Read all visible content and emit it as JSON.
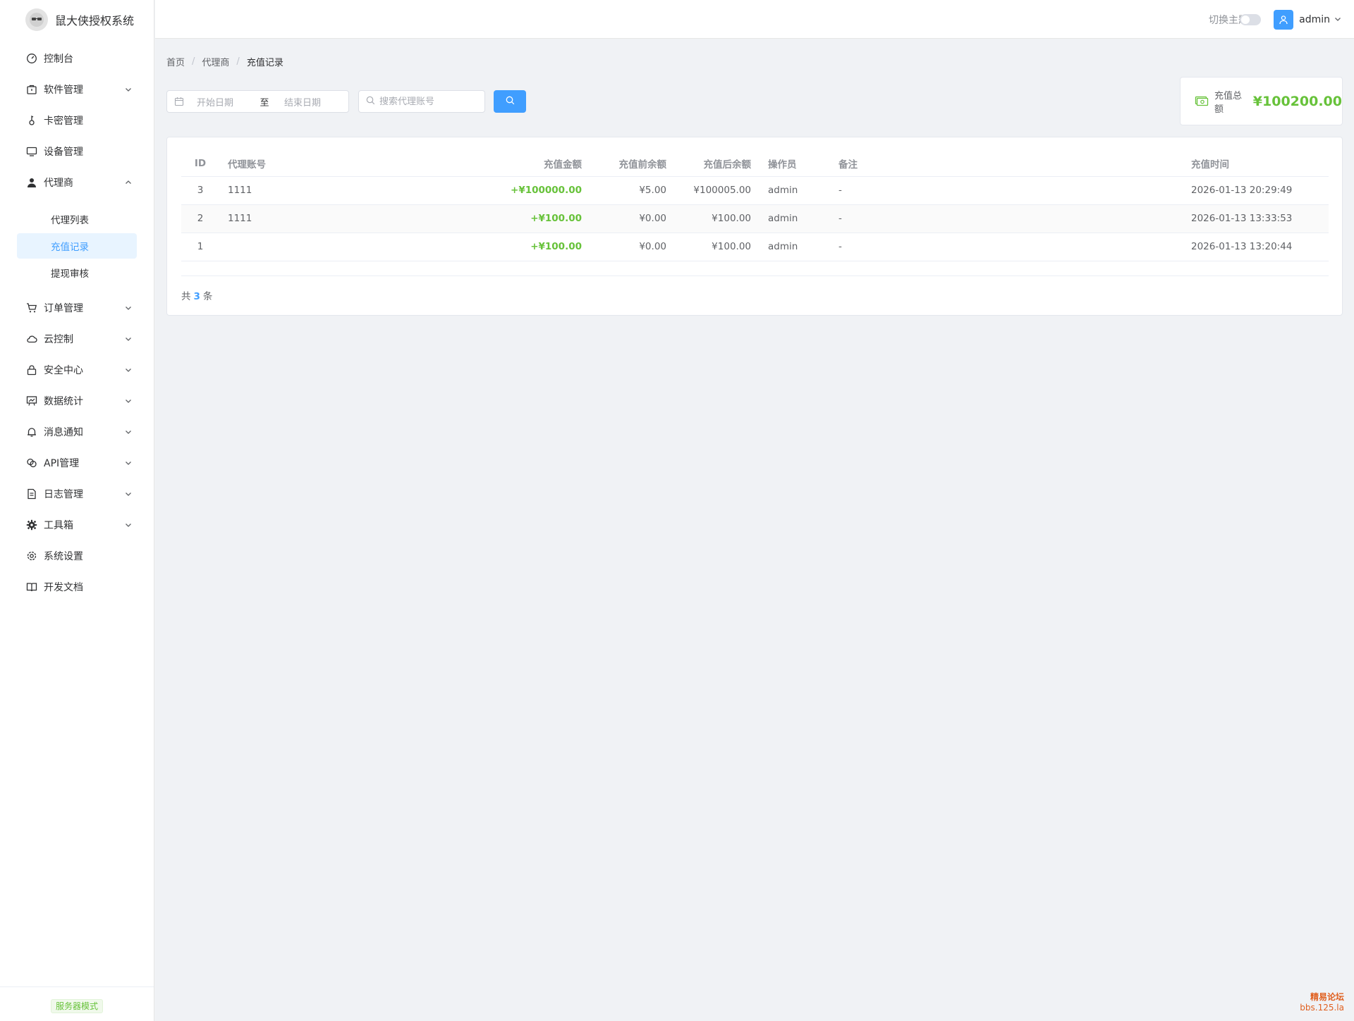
{
  "app": {
    "title": "鼠大侠授权系统"
  },
  "sidebar": {
    "items": [
      {
        "label": "控制台",
        "icon": "dashboard-icon",
        "has_children": false
      },
      {
        "label": "软件管理",
        "icon": "package-icon",
        "has_children": true
      },
      {
        "label": "卡密管理",
        "icon": "key-icon",
        "has_children": false
      },
      {
        "label": "设备管理",
        "icon": "monitor-icon",
        "has_children": false
      },
      {
        "label": "代理商",
        "icon": "user-icon",
        "has_children": true,
        "expanded": true,
        "children": [
          {
            "label": "代理列表"
          },
          {
            "label": "充值记录",
            "active": true
          },
          {
            "label": "提现审核"
          }
        ]
      },
      {
        "label": "订单管理",
        "icon": "cart-icon",
        "has_children": true
      },
      {
        "label": "云控制",
        "icon": "cloud-icon",
        "has_children": true
      },
      {
        "label": "安全中心",
        "icon": "lock-icon",
        "has_children": true
      },
      {
        "label": "数据统计",
        "icon": "chart-icon",
        "has_children": true
      },
      {
        "label": "消息通知",
        "icon": "bell-icon",
        "has_children": true
      },
      {
        "label": "API管理",
        "icon": "link-icon",
        "has_children": true
      },
      {
        "label": "日志管理",
        "icon": "document-icon",
        "has_children": true
      },
      {
        "label": "工具箱",
        "icon": "gear-solid-icon",
        "has_children": true
      },
      {
        "label": "系统设置",
        "icon": "settings-icon",
        "has_children": false
      },
      {
        "label": "开发文档",
        "icon": "book-icon",
        "has_children": false
      }
    ],
    "mode_badge": "服务器模式"
  },
  "header": {
    "theme_toggle_label": "切换主题",
    "theme_dark": false,
    "username": "admin"
  },
  "breadcrumb": [
    "首页",
    "代理商",
    "充值记录"
  ],
  "filters": {
    "start_placeholder": "开始日期",
    "range_separator": "至",
    "end_placeholder": "结束日期",
    "search_placeholder": "搜索代理账号"
  },
  "summary": {
    "label": "充值总额",
    "value": "¥100200.00"
  },
  "table": {
    "columns": [
      "ID",
      "代理账号",
      "充值金额",
      "充值前余额",
      "充值后余额",
      "操作员",
      "备注",
      "充值时间"
    ],
    "rows": [
      {
        "id": "3",
        "account": "1111",
        "amount": "+¥100000.00",
        "before": "¥5.00",
        "after": "¥100005.00",
        "operator": "admin",
        "note": "-",
        "time": "2026-01-13 20:29:49"
      },
      {
        "id": "2",
        "account": "1111",
        "amount": "+¥100.00",
        "before": "¥0.00",
        "after": "¥100.00",
        "operator": "admin",
        "note": "-",
        "time": "2026-01-13 13:33:53"
      },
      {
        "id": "1",
        "account": "",
        "amount": "+¥100.00",
        "before": "¥0.00",
        "after": "¥100.00",
        "operator": "admin",
        "note": "-",
        "time": "2026-01-13 13:20:44"
      }
    ]
  },
  "pagination": {
    "prefix": "共",
    "total": "3",
    "suffix": "条"
  },
  "watermark": {
    "line1": "精易论坛",
    "line2": "bbs.125.la"
  },
  "colors": {
    "primary": "#409eff",
    "success": "#67c23a",
    "active_bg": "#e8f4ff"
  }
}
